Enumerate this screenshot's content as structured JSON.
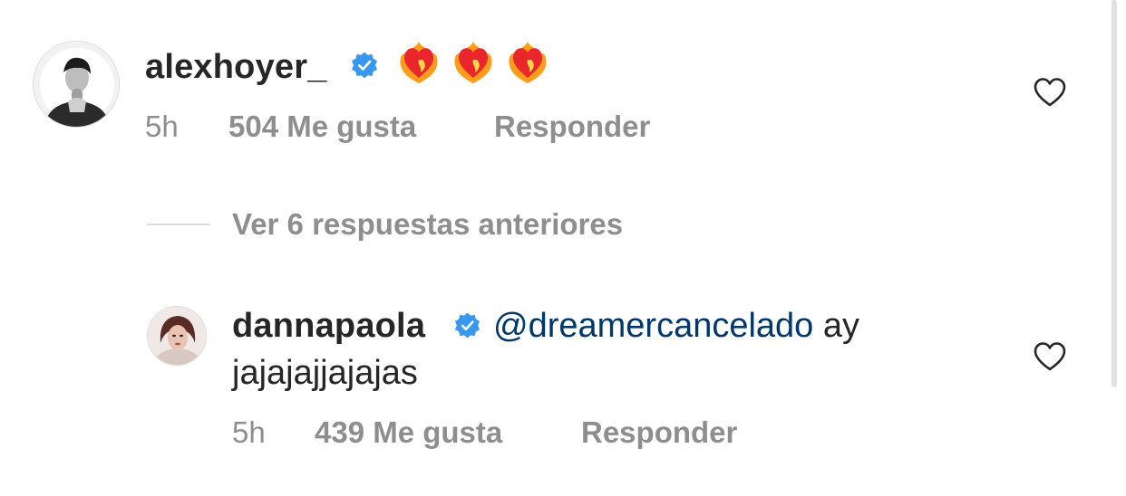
{
  "comment": {
    "username": "alexhoyer_",
    "emojis": [
      "❤️‍🔥",
      "❤️‍🔥",
      "❤️‍🔥"
    ],
    "time": "5h",
    "likes": "504 Me gusta",
    "reply_label": "Responder"
  },
  "view_replies": "Ver 6 respuestas anteriores",
  "reply": {
    "username": "dannapaola",
    "mention": "@dreamercancelado",
    "text_line1_after": " ay",
    "text_line2": "jajajajjajajas",
    "time": "5h",
    "likes": "439 Me gusta",
    "reply_label": "Responder"
  },
  "colors": {
    "verified_badge": "#3897f0",
    "mention": "#00376b",
    "meta": "#8e8e8e",
    "text": "#262626"
  },
  "icons": {
    "verified": "verified-badge-icon",
    "like": "heart-outline-icon"
  }
}
